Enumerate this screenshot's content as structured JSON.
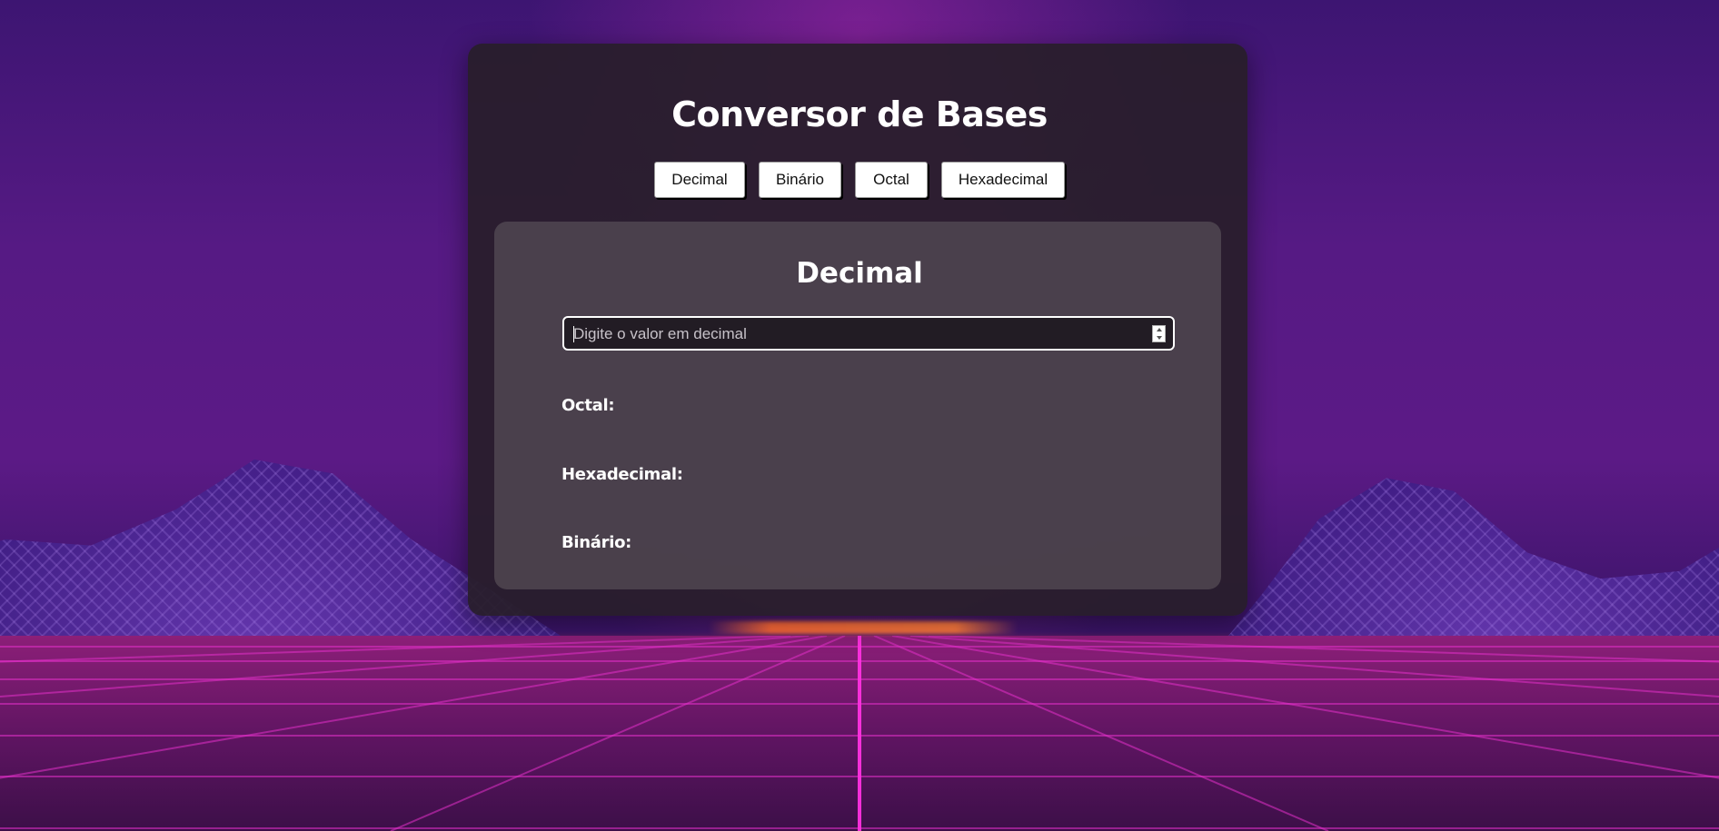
{
  "title": "Conversor de Bases",
  "tabs": [
    {
      "label": "Decimal"
    },
    {
      "label": "Binário"
    },
    {
      "label": "Octal"
    },
    {
      "label": "Hexadecimal"
    }
  ],
  "panel": {
    "title": "Decimal",
    "input": {
      "value": "",
      "placeholder": "Digite o valor em decimal"
    },
    "results": [
      {
        "label": "Octal:",
        "value": ""
      },
      {
        "label": "Hexadecimal:",
        "value": ""
      },
      {
        "label": "Binário:",
        "value": ""
      }
    ]
  },
  "colors": {
    "background_top": "#3d1572",
    "ground": "#8c1f78",
    "grid_line": "#ff2bd6",
    "card": "#281e2a",
    "panel": "#4e4650"
  }
}
